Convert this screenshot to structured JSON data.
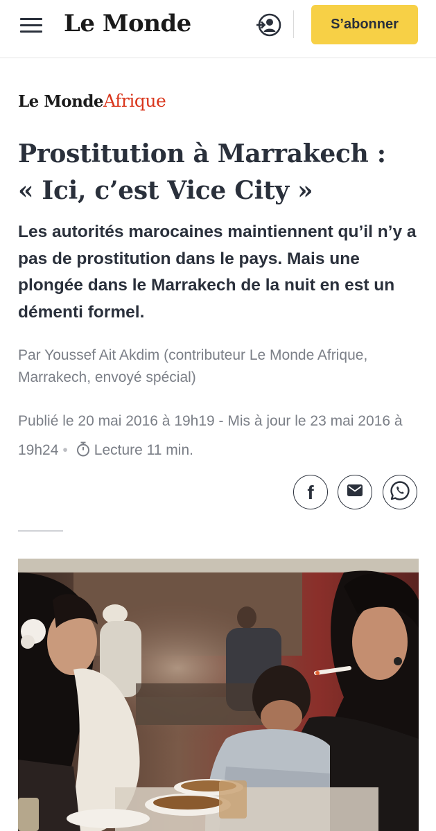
{
  "header": {
    "menu_icon": "hamburger-menu-icon",
    "logo": "Le Monde",
    "account_icon": "user-login-icon",
    "subscribe_label": "S’abonner",
    "subscribe_color": "#f7d046"
  },
  "section": {
    "logo_part1": "Le Monde",
    "logo_part2": "Afrique",
    "accent_color": "#d9361c"
  },
  "article": {
    "title_line1": "Prostitution à Marrakech :",
    "title_line2": "« Ici, c’est Vice City »",
    "lead": "Les autorités marocaines maintiennent qu’il n’y a pas de prostitution dans le pays. Mais une plongée dans le Marrakech de la nuit en est un démenti formel.",
    "byline": "Par Youssef Ait Akdim (contributeur Le Monde Afrique, Marrakech, envoyé spécial)",
    "published": "Publié le 20 mai 2016 à 19h19 - Mis à jour le 23 mai 2016 à 19h24",
    "separator": "•",
    "reading_time": "Lecture 11 min.",
    "clock_icon": "stopwatch-icon"
  },
  "share": {
    "facebook_icon": "facebook-icon",
    "facebook_glyph": "f",
    "email_icon": "email-icon",
    "whatsapp_icon": "whatsapp-icon"
  },
  "photo": {
    "description_icon": "article-photo"
  }
}
